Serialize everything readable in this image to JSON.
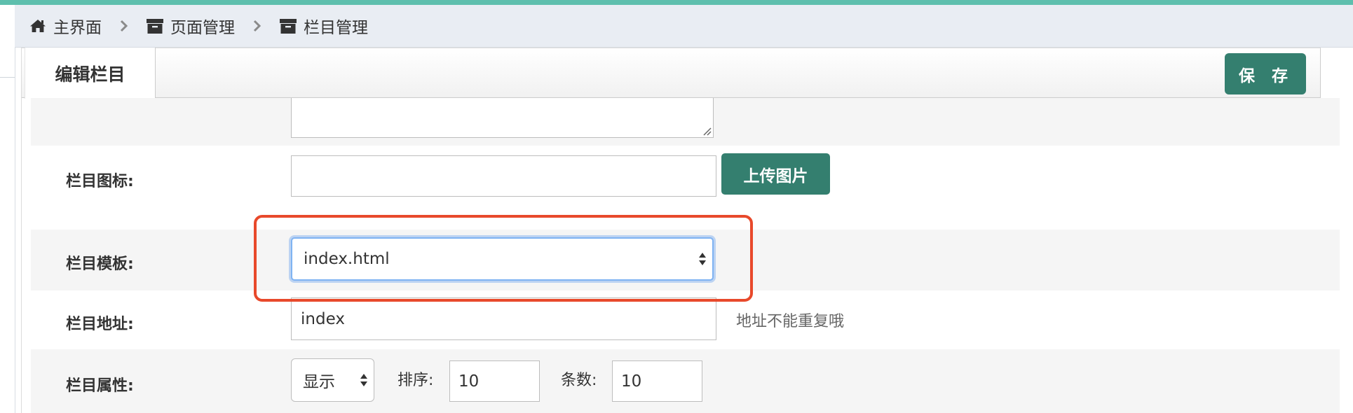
{
  "breadcrumb": {
    "items": [
      {
        "label": "主界面",
        "icon": "home-icon"
      },
      {
        "label": "页面管理",
        "icon": "archive-icon"
      },
      {
        "label": "栏目管理",
        "icon": "archive-icon"
      }
    ]
  },
  "tabs": {
    "active_label": "编辑栏目"
  },
  "toolbar": {
    "save_label": "保 存"
  },
  "form": {
    "description": {
      "value": ""
    },
    "icon_field": {
      "label": "栏目图标:",
      "value": "",
      "upload_label": "上传图片"
    },
    "template_field": {
      "label": "栏目模板:",
      "selected": "index.html"
    },
    "address_field": {
      "label": "栏目地址:",
      "value": "index",
      "hint": "地址不能重复哦"
    },
    "attributes_field": {
      "label": "栏目属性:",
      "visibility_selected": "显示",
      "sort_label": "排序:",
      "sort_value": "10",
      "count_label": "条数:",
      "count_value": "10"
    }
  },
  "colors": {
    "accent": "#5ebfad",
    "button": "#347f6f",
    "highlight": "#e8492b",
    "focus": "#7fb3f2"
  }
}
